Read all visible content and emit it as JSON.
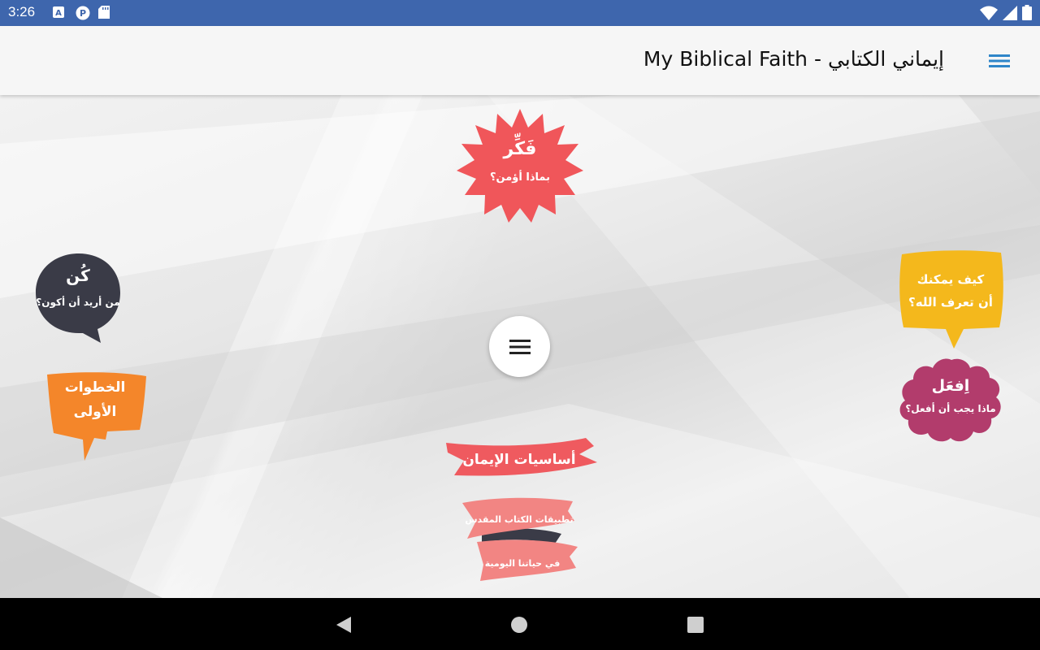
{
  "status_bar": {
    "time": "3:26",
    "icons_left": [
      "a-notification-icon",
      "p-notification-icon",
      "sd-card-icon"
    ],
    "icons_right": [
      "wifi-icon",
      "signal-icon",
      "battery-icon"
    ]
  },
  "app_bar": {
    "title": "My Biblical Faith - إيماني الكتابي",
    "menu_icon": "hamburger-menu-icon",
    "accent": "#2f86c9"
  },
  "badges": {
    "think": {
      "title": "فَكِّر",
      "subtitle": "بماذا أؤمن؟",
      "color": "#f0565a"
    },
    "be": {
      "title": "كُن",
      "subtitle": "من أريد أن أكون؟",
      "color": "#3a3b47"
    },
    "first_steps": {
      "line1": "الخطوات",
      "line2": "الأولى",
      "color": "#f4862a"
    },
    "know_god": {
      "line1": "كيف يمكنك",
      "line2": "أن تعرف الله؟",
      "color": "#f4b81c"
    },
    "do": {
      "title": "اِفعَل",
      "subtitle": "ماذا يجب أن أفعل؟",
      "color": "#b23c6c"
    },
    "basics": {
      "label": "أساسيات الإيمان",
      "color": "#ef5a5f"
    },
    "applications": {
      "line1": "تطبيقات الكتاب المقدس",
      "line2": "في حياتنا اليومية",
      "color": "#f28583"
    }
  },
  "center_menu_icon": "menu-icon",
  "nav_bar": {
    "back": "back-icon",
    "home": "home-icon",
    "recents": "recents-icon"
  }
}
